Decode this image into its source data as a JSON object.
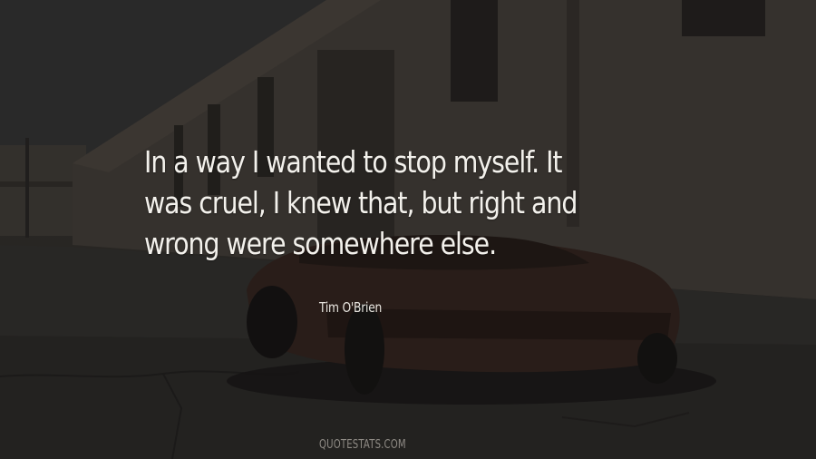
{
  "quote": {
    "lines": [
      "In a way I wanted to stop myself. It",
      "was cruel, I knew that, but right and",
      "wrong were somewhere else."
    ]
  },
  "author": "Tim O'Brien",
  "watermark": "QUOTESTATS.COM"
}
